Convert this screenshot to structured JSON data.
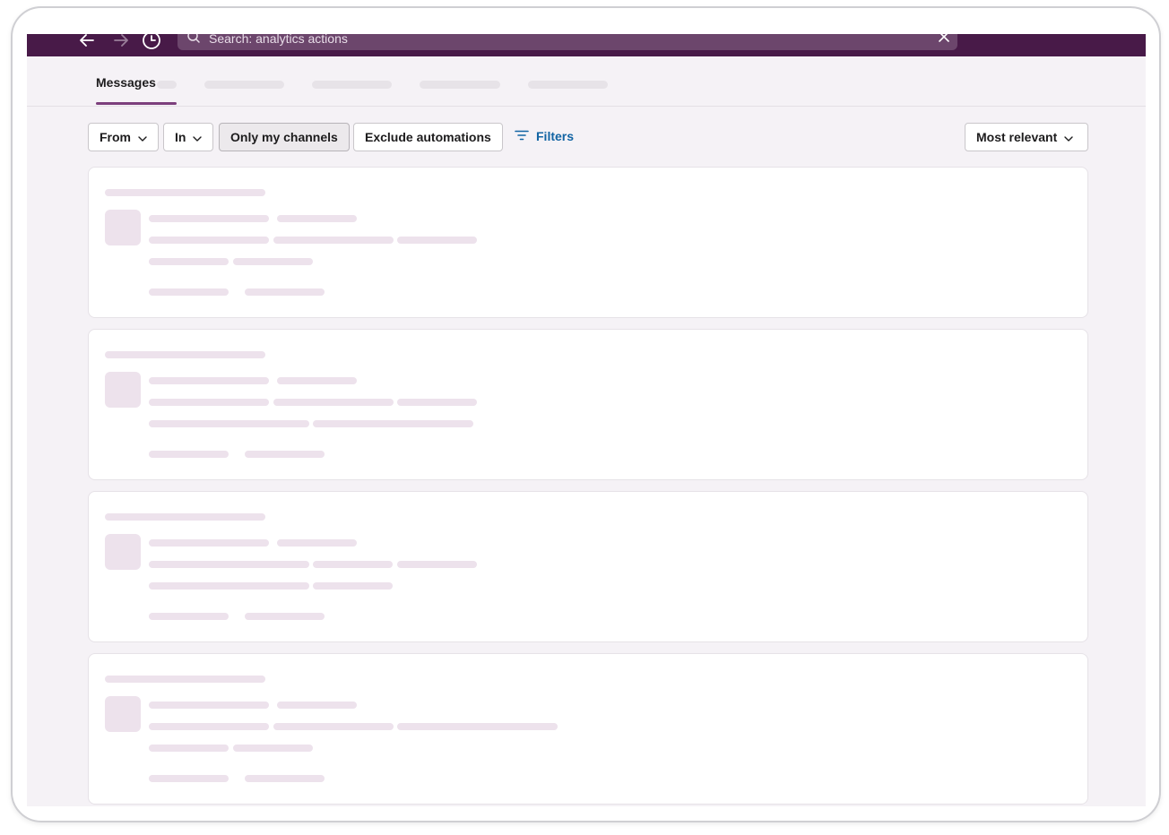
{
  "search": {
    "query": "Search: analytics actions"
  },
  "nav": {
    "back_icon": "arrow-left-icon",
    "forward_icon": "arrow-right-icon",
    "history_icon": "clock-icon"
  },
  "tabs": {
    "active_label": "Messages"
  },
  "filters": {
    "from_label": "From",
    "in_label": "In",
    "only_my_channels_label": "Only my channels",
    "exclude_automations_label": "Exclude automations",
    "filters_label": "Filters",
    "sort_label": "Most relevant"
  },
  "colors": {
    "topbar": "#481a48",
    "accent": "#7c3f7c",
    "link": "#1264a3",
    "skeleton": "#ede2ec"
  },
  "results": {
    "state": "loading"
  }
}
